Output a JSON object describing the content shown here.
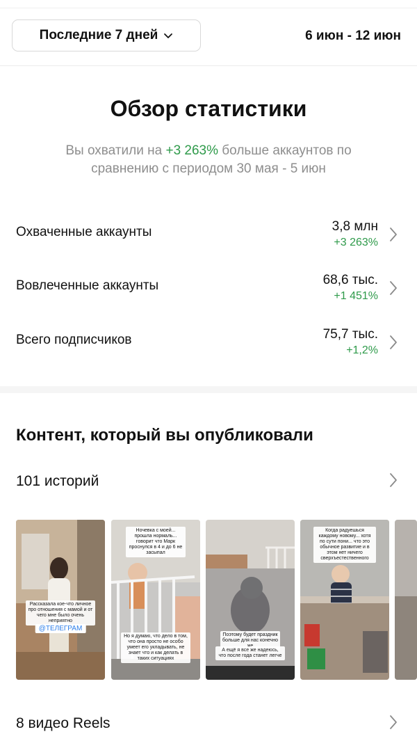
{
  "header": {
    "range_label": "Последние 7 дней",
    "date_range": "6 июн - 12 июн"
  },
  "overview": {
    "title": "Обзор статистики",
    "summary_prefix": "Вы охватили на ",
    "summary_highlight": "+3 263%",
    "summary_suffix": " больше аккаунтов по сравнению с периодом 30 мая - 5 июн"
  },
  "metrics": [
    {
      "label": "Охваченные аккаунты",
      "value": "3,8 млн",
      "delta": "+3 263%"
    },
    {
      "label": "Вовлеченные аккаунты",
      "value": "68,6 тыс.",
      "delta": "+1 451%"
    },
    {
      "label": "Всего подписчиков",
      "value": "75,7 тыс.",
      "delta": "+1,2%"
    }
  ],
  "content": {
    "title": "Контент, который вы опубликовали",
    "stories_label": "101 историй",
    "reels_label": "8 видео Reels",
    "stories": [
      {
        "caption": "Рассказала кое-что личное про отношения с мамой и от чего мне было очень неприятно",
        "tag": "@ТЕЛЕГРАМ"
      },
      {
        "caption_top": "Ночевка с моей... прошла нормаль... говорит что Марк проснулся в 4 и до 6 не засыпал",
        "caption_bottom": "Но я думаю, что дело в том, что она просто не особо умеет его укладывать, не знает что и как делать в таких ситуациях"
      },
      {
        "caption_mid": "Поэтому будет праздник больше для нас конечно же",
        "caption_bottom": "А ещё я все же надеюсь, что после года станет легче"
      },
      {
        "caption_top": "Когда радуешься каждому новому... хотя по сути пони... что это обычное развитие и в этом нет ничего сверхъестественного"
      }
    ]
  },
  "colors": {
    "positive": "#2e9a4a",
    "muted_text": "#8e8e8e",
    "link": "#2b7de9"
  }
}
